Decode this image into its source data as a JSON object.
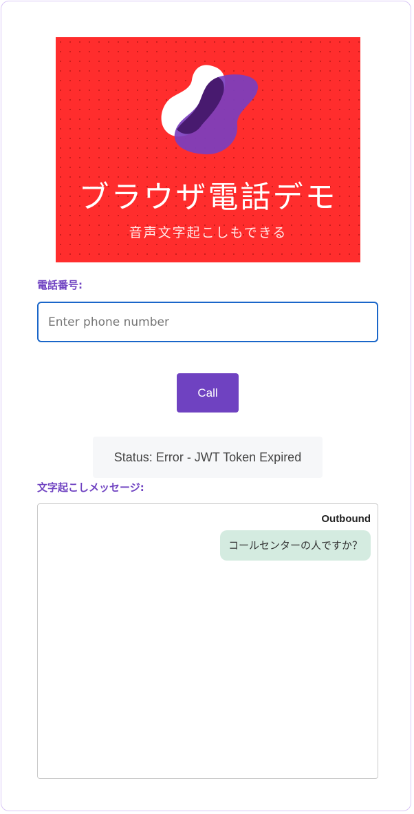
{
  "banner": {
    "title": "ブラウザ電話デモ",
    "subtitle": "音声文字起こしもできる",
    "logo_icon": "blob-logo-icon",
    "colors": {
      "background": "#ff2d2d",
      "blob_white": "#ffffff",
      "blob_purple": "#7b3fbf"
    }
  },
  "phone": {
    "label": "電話番号:",
    "placeholder": "Enter phone number",
    "value": ""
  },
  "call_button": {
    "label": "Call"
  },
  "status": {
    "text": "Status: Error - JWT Token Expired"
  },
  "transcript": {
    "label": "文字起こしメッセージ:",
    "messages": [
      {
        "direction": "Outbound",
        "text": "コールセンターの人ですか？"
      }
    ]
  },
  "colors": {
    "accent": "#6f42c1",
    "input_focus_border": "#1a66c9",
    "bubble_bg": "#d4ebe0",
    "status_bg": "#f6f7f9"
  }
}
